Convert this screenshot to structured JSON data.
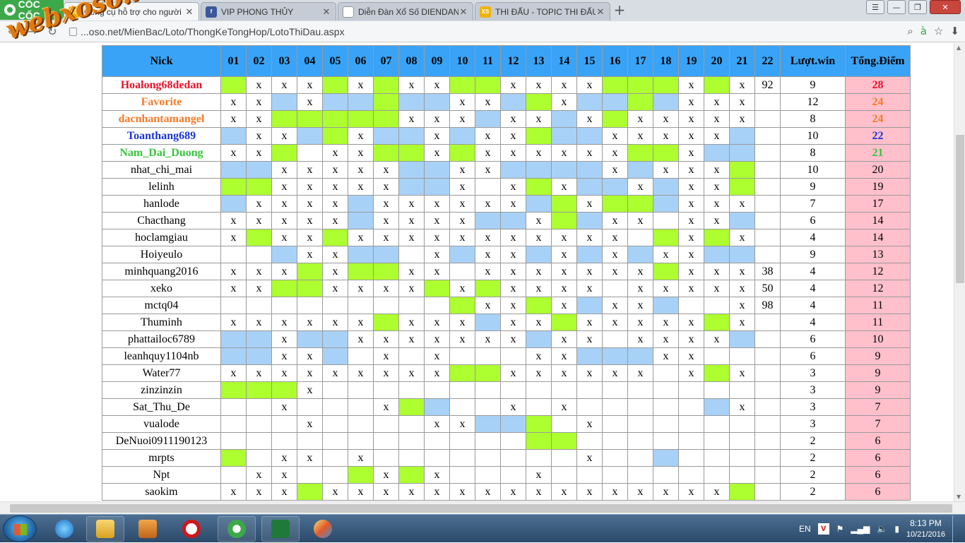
{
  "browser": {
    "logo_text": "CỐC CỐC",
    "tabs": [
      {
        "title": "Công cụ hỗ trợ cho người",
        "icon": "xs-icon",
        "active": true
      },
      {
        "title": "VIP PHONG THỦY",
        "icon": "facebook-icon",
        "active": false
      },
      {
        "title": "Diễn Đàn Xổ Số DIENDAN",
        "icon": "page-icon",
        "active": false
      },
      {
        "title": "THI ĐẤU - TOPIC THI ĐẤU",
        "icon": "xs-icon",
        "active": false
      }
    ],
    "url": "...oso.net/MienBac/Loto/ThongKeTongHop/LotoThiDau.aspx",
    "watermark": "webxoso.net"
  },
  "table": {
    "headers": {
      "nick": "Nick",
      "numbers": [
        "01",
        "02",
        "03",
        "04",
        "05",
        "06",
        "07",
        "08",
        "09",
        "10",
        "11",
        "12",
        "13",
        "14",
        "15",
        "16",
        "17",
        "18",
        "19",
        "20",
        "21",
        "22"
      ],
      "wins": "Lượt.win",
      "points": "Tổng.Điểm"
    },
    "rows": [
      {
        "nick": "Hoalong68dedan",
        "style": "red",
        "cells": [
          "g",
          "x",
          "x",
          "x",
          "g",
          "x",
          "g",
          "x",
          "x",
          "g",
          "g",
          "x",
          "x",
          "x",
          "x",
          "g",
          "g",
          "g",
          "x",
          "g",
          "x",
          "92"
        ],
        "wins": "9",
        "points": "28"
      },
      {
        "nick": "Favorite",
        "style": "orange",
        "cells": [
          "x",
          "x",
          "b",
          "x",
          "b",
          "b",
          "g",
          "b",
          "b",
          "x",
          "x",
          "b",
          "g",
          "x",
          "b",
          "b",
          "g",
          "b",
          "x",
          "x",
          "x",
          ""
        ],
        "wins": "12",
        "points": "24"
      },
      {
        "nick": "dacnhantamangel",
        "style": "orange",
        "cells": [
          "x",
          "x",
          "g",
          "g",
          "g",
          "g",
          "g",
          "x",
          "x",
          "x",
          "b",
          "x",
          "x",
          "b",
          "x",
          "g",
          "x",
          "x",
          "x",
          "x",
          "x",
          ""
        ],
        "wins": "8",
        "points": "24"
      },
      {
        "nick": "Toanthang689",
        "style": "blue",
        "cells": [
          "b",
          "x",
          "x",
          "b",
          "g",
          "x",
          "b",
          "b",
          "x",
          "b",
          "x",
          "x",
          "g",
          "b",
          "b",
          "x",
          "x",
          "x",
          "x",
          "x",
          "b",
          ""
        ],
        "wins": "10",
        "points": "22"
      },
      {
        "nick": "Nam_Dai_Duong",
        "style": "green",
        "cells": [
          "x",
          "x",
          "g",
          "",
          "x",
          "x",
          "g",
          "g",
          "x",
          "g",
          "x",
          "x",
          "x",
          "x",
          "x",
          "x",
          "g",
          "g",
          "x",
          "b",
          "b",
          ""
        ],
        "wins": "8",
        "points": "21"
      },
      {
        "nick": "nhat_chi_mai",
        "style": "",
        "cells": [
          "b",
          "b",
          "x",
          "x",
          "x",
          "x",
          "x",
          "b",
          "b",
          "x",
          "x",
          "b",
          "b",
          "b",
          "b",
          "x",
          "b",
          "x",
          "x",
          "x",
          "g",
          ""
        ],
        "wins": "10",
        "points": "20"
      },
      {
        "nick": "lelinh",
        "style": "",
        "cells": [
          "g",
          "g",
          "x",
          "x",
          "x",
          "x",
          "x",
          "b",
          "b",
          "x",
          "",
          "x",
          "g",
          "x",
          "b",
          "b",
          "x",
          "b",
          "x",
          "x",
          "g",
          ""
        ],
        "wins": "9",
        "points": "19"
      },
      {
        "nick": "hanlode",
        "style": "",
        "cells": [
          "b",
          "x",
          "x",
          "x",
          "x",
          "b",
          "x",
          "x",
          "x",
          "x",
          "x",
          "x",
          "b",
          "g",
          "x",
          "g",
          "g",
          "b",
          "x",
          "x",
          "x",
          ""
        ],
        "wins": "7",
        "points": "17"
      },
      {
        "nick": "Chacthang",
        "style": "",
        "cells": [
          "x",
          "x",
          "x",
          "x",
          "x",
          "b",
          "x",
          "x",
          "x",
          "x",
          "b",
          "b",
          "x",
          "g",
          "b",
          "x",
          "x",
          "",
          "x",
          "x",
          "b",
          ""
        ],
        "wins": "6",
        "points": "14"
      },
      {
        "nick": "hoclamgiau",
        "style": "",
        "cells": [
          "x",
          "g",
          "x",
          "x",
          "g",
          "x",
          "x",
          "x",
          "x",
          "x",
          "x",
          "x",
          "x",
          "x",
          "x",
          "x",
          "",
          "g",
          "x",
          "g",
          "x",
          ""
        ],
        "wins": "4",
        "points": "14"
      },
      {
        "nick": "Hoiyeulo",
        "style": "",
        "cells": [
          "",
          "",
          "b",
          "x",
          "x",
          "b",
          "b",
          "",
          "x",
          "b",
          "x",
          "x",
          "b",
          "x",
          "b",
          "x",
          "b",
          "x",
          "x",
          "b",
          "b",
          ""
        ],
        "wins": "9",
        "points": "13"
      },
      {
        "nick": "minhquang2016",
        "style": "",
        "cells": [
          "x",
          "x",
          "x",
          "g",
          "x",
          "g",
          "g",
          "x",
          "x",
          "",
          "x",
          "x",
          "x",
          "x",
          "x",
          "x",
          "x",
          "g",
          "x",
          "x",
          "x",
          "38"
        ],
        "wins": "4",
        "points": "12"
      },
      {
        "nick": "xeko",
        "style": "",
        "cells": [
          "x",
          "x",
          "g",
          "g",
          "x",
          "x",
          "x",
          "x",
          "g",
          "x",
          "g",
          "x",
          "x",
          "x",
          "x",
          "",
          "x",
          "x",
          "x",
          "x",
          "x",
          "50"
        ],
        "wins": "4",
        "points": "12"
      },
      {
        "nick": "mctq04",
        "style": "",
        "cells": [
          "",
          "",
          "",
          "",
          "",
          "",
          "",
          "",
          "",
          "g",
          "x",
          "x",
          "g",
          "x",
          "b",
          "x",
          "x",
          "b",
          "",
          "",
          "x",
          "98"
        ],
        "wins": "4",
        "points": "11"
      },
      {
        "nick": "Thuminh",
        "style": "",
        "cells": [
          "x",
          "x",
          "x",
          "x",
          "x",
          "x",
          "g",
          "x",
          "x",
          "x",
          "b",
          "x",
          "x",
          "g",
          "x",
          "x",
          "x",
          "x",
          "x",
          "g",
          "x",
          ""
        ],
        "wins": "4",
        "points": "11"
      },
      {
        "nick": "phattailoc6789",
        "style": "",
        "cells": [
          "b",
          "b",
          "x",
          "b",
          "b",
          "x",
          "x",
          "x",
          "x",
          "x",
          "x",
          "x",
          "b",
          "x",
          "x",
          "",
          "x",
          "x",
          "x",
          "x",
          "b",
          ""
        ],
        "wins": "6",
        "points": "10"
      },
      {
        "nick": "leanhquy1104nb",
        "style": "",
        "cells": [
          "b",
          "b",
          "x",
          "x",
          "b",
          "",
          "x",
          "",
          "x",
          "",
          "",
          "",
          "x",
          "x",
          "b",
          "b",
          "b",
          "x",
          "x",
          "",
          "",
          ""
        ],
        "wins": "6",
        "points": "9"
      },
      {
        "nick": "Water77",
        "style": "",
        "cells": [
          "x",
          "x",
          "x",
          "x",
          "x",
          "x",
          "x",
          "x",
          "x",
          "g",
          "g",
          "x",
          "x",
          "x",
          "x",
          "x",
          "x",
          "",
          "x",
          "g",
          "x",
          ""
        ],
        "wins": "3",
        "points": "9"
      },
      {
        "nick": "zinzinzin",
        "style": "",
        "cells": [
          "g",
          "g",
          "g",
          "x",
          "",
          "",
          "",
          "",
          "",
          "",
          "",
          "",
          "",
          "",
          "",
          "",
          "",
          "",
          "",
          "",
          "",
          ""
        ],
        "wins": "3",
        "points": "9"
      },
      {
        "nick": "Sat_Thu_De",
        "style": "",
        "cells": [
          "",
          "",
          "x",
          "",
          "",
          "",
          "x",
          "g",
          "b",
          "",
          "",
          "x",
          "",
          "x",
          "",
          "",
          "",
          "",
          "",
          "b",
          "x",
          ""
        ],
        "wins": "3",
        "points": "7"
      },
      {
        "nick": "vualode",
        "style": "",
        "cells": [
          "",
          "",
          "",
          "x",
          "",
          "",
          "",
          "",
          "x",
          "x",
          "b",
          "b",
          "g",
          "",
          "x",
          "",
          "",
          "",
          "",
          "",
          "",
          ""
        ],
        "wins": "3",
        "points": "7"
      },
      {
        "nick": "DeNuoi0911190123",
        "style": "",
        "cells": [
          "",
          "",
          "",
          "",
          "",
          "",
          "",
          "",
          "",
          "",
          "",
          "",
          "g",
          "g",
          "",
          "",
          "",
          "",
          "",
          "",
          "",
          ""
        ],
        "wins": "2",
        "points": "6"
      },
      {
        "nick": "mrpts",
        "style": "",
        "cells": [
          "g",
          "",
          "x",
          "x",
          "",
          "x",
          "",
          "",
          "",
          "",
          "",
          "",
          "",
          "",
          "x",
          "",
          "",
          "b",
          "",
          "",
          "",
          ""
        ],
        "wins": "2",
        "points": "6"
      },
      {
        "nick": "Npt",
        "style": "",
        "cells": [
          "",
          "x",
          "x",
          "",
          "",
          "g",
          "x",
          "g",
          "x",
          "",
          "",
          "",
          "x",
          "",
          "",
          "",
          "",
          "",
          "",
          "",
          "",
          ""
        ],
        "wins": "2",
        "points": "6"
      },
      {
        "nick": "saokim",
        "style": "",
        "cells": [
          "x",
          "x",
          "x",
          "g",
          "x",
          "x",
          "x",
          "x",
          "x",
          "x",
          "x",
          "x",
          "x",
          "x",
          "x",
          "x",
          "x",
          "x",
          "x",
          "x",
          "g",
          ""
        ],
        "wins": "2",
        "points": "6"
      }
    ]
  },
  "taskbar": {
    "language": "EN",
    "time": "8:13 PM",
    "date": "10/21/2016"
  },
  "colors": {
    "header_bg": "#39a4f7",
    "hit_green": "#adff2f",
    "hit_blue": "#a8d1f7",
    "points_bg": "#ffc0cb"
  }
}
